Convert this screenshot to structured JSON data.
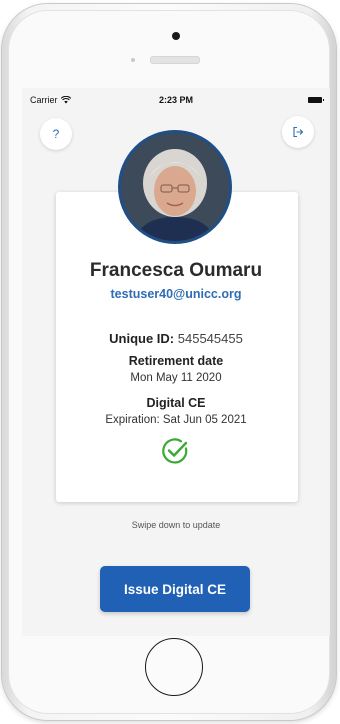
{
  "status_bar": {
    "carrier": "Carrier",
    "time": "2:23 PM"
  },
  "header": {
    "help_label": "?",
    "logout_icon": "logout-icon"
  },
  "profile": {
    "name": "Francesca Oumaru",
    "email": "testuser40@unicc.org",
    "unique_id_label": "Unique ID:",
    "unique_id_value": "545545455",
    "retirement_label": "Retirement date",
    "retirement_value": "Mon May 11 2020",
    "digital_ce_label": "Digital CE",
    "expiration_value": "Expiration: Sat Jun 05 2021",
    "status_icon": "check-circle-icon"
  },
  "footer": {
    "swipe_hint": "Swipe down to update",
    "issue_button_label": "Issue Digital CE"
  },
  "colors": {
    "accent": "#2061b5",
    "link": "#2f6db5",
    "success": "#3aaa35"
  }
}
